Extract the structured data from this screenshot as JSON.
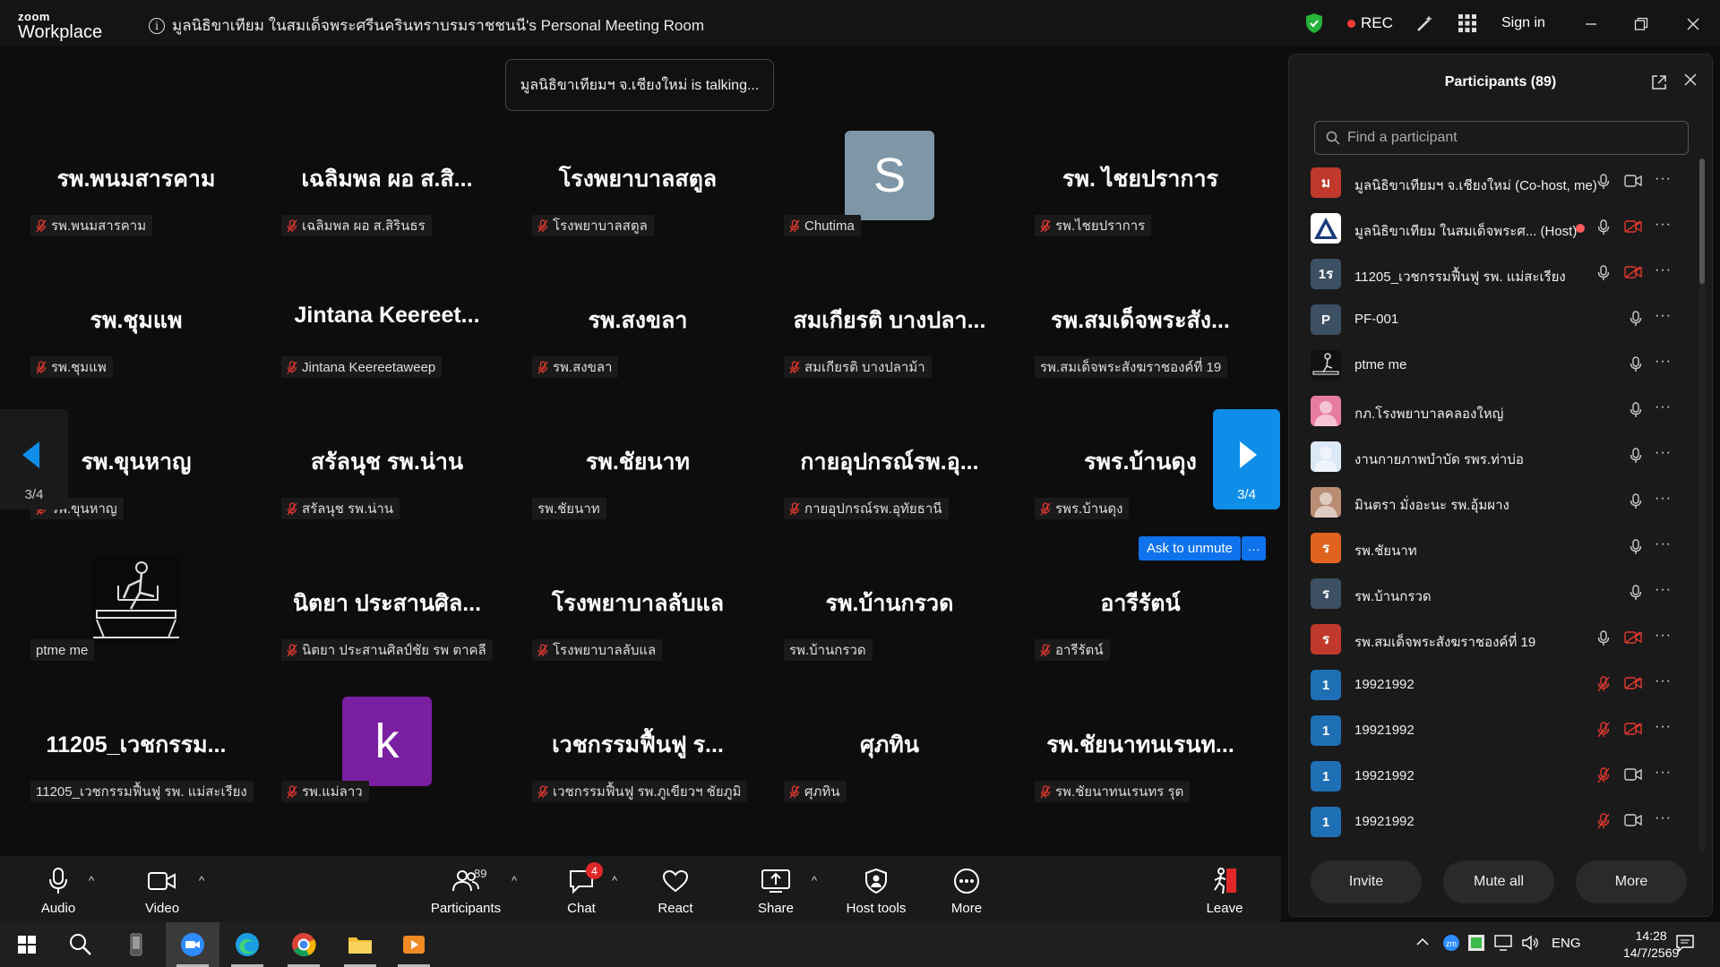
{
  "app": {
    "logo_line1": "zoom",
    "logo_line2": "Workplace",
    "meeting_title": "มูลนิธิขาเทียม ในสมเด็จพระศรีนครินทราบรมราชชนนี's Personal Meeting Room",
    "rec_label": "REC",
    "signin_label": "Sign in"
  },
  "gallery": {
    "talking_banner": "มูลนิธิขาเทียมฯ จ.เชียงใหม่ is talking...",
    "page_indicator_left": "3/4",
    "page_indicator_right": "3/4",
    "ask_unmute_label": "Ask to unmute",
    "ask_more_label": "···",
    "tiles": [
      {
        "big": "รพ.พนมสารคาม",
        "name": "รพ.พนมสารคาม",
        "muted": true
      },
      {
        "big": "เฉลิมพล  ผอ ส.สิ...",
        "name": "เฉลิมพล  ผอ ส.สิรินธร",
        "muted": true
      },
      {
        "big": "โรงพยาบาลสตูล",
        "name": "โรงพยาบาลสตูล",
        "muted": true
      },
      {
        "big": "",
        "name": "Chutima",
        "muted": true,
        "avatar": "S",
        "avatar_color": "#7e96a6"
      },
      {
        "big": "รพ. ไชยปราการ",
        "name": "รพ.ไชยปราการ",
        "muted": true
      },
      {
        "big": "รพ.ชุมแพ",
        "name": "รพ.ชุมแพ",
        "muted": true
      },
      {
        "big": "Jintana  Keereet...",
        "name": "Jintana Keereetaweep",
        "muted": true
      },
      {
        "big": "รพ.สงขลา",
        "name": "รพ.สงขลา",
        "muted": true
      },
      {
        "big": "สมเกียรติ บางปลา...",
        "name": "สมเกียรติ บางปลาม้า",
        "muted": true
      },
      {
        "big": "รพ.สมเด็จพระสัง...",
        "name": "รพ.สมเด็จพระสังฆราชองค์ที่ 19",
        "muted": false
      },
      {
        "big": "รพ.ขุนหาญ",
        "name": "รพ.ขุนหาญ",
        "muted": true
      },
      {
        "big": "สรัลนุช รพ.น่าน",
        "name": "สรัลนุช รพ.น่าน",
        "muted": true
      },
      {
        "big": "รพ.ชัยนาท",
        "name": "รพ.ชัยนาท",
        "muted": false
      },
      {
        "big": "กายอุปกรณ์รพ.อุ...",
        "name": "กายอุปกรณ์รพ.อุทัยธานี",
        "muted": true
      },
      {
        "big": "รพร.บ้านดุง",
        "name": "รพร.บ้านดุง",
        "muted": true
      },
      {
        "big": "",
        "name": "ptme me",
        "muted": false,
        "avatar": "image",
        "avatar_color": "#0a0a0a"
      },
      {
        "big": "นิตยา ประสานศิล...",
        "name": "นิตยา ประสานศิลป์ชัย รพ ตาคลี",
        "muted": true
      },
      {
        "big": "โรงพยาบาลลับแล",
        "name": "โรงพยาบาลลับแล",
        "muted": true
      },
      {
        "big": "รพ.บ้านกรวด",
        "name": "รพ.บ้านกรวด",
        "muted": false
      },
      {
        "big": "อารีรัตน์",
        "name": "อารีรัตน์",
        "muted": true
      },
      {
        "big": "11205_เวชกรรม...",
        "name": "11205_เวชกรรมฟื้นฟู รพ. แม่สะเรียง",
        "muted": false
      },
      {
        "big": "",
        "name": "รพ.แม่ลาว",
        "muted": true,
        "avatar": "k",
        "avatar_color": "#7a1fa2"
      },
      {
        "big": "เวชกรรมฟื้นฟู ร...",
        "name": "เวชกรรมฟื้นฟู รพ.ภูเขียวฯ ชัยภูมิ",
        "muted": true
      },
      {
        "big": "ศุภทิน",
        "name": "ศุภทิน",
        "muted": true
      },
      {
        "big": "รพ.ชัยนาทนเรนท...",
        "name": "รพ.ชัยนาทนเรนทร รุต",
        "muted": true
      }
    ]
  },
  "toolbar": {
    "audio": "Audio",
    "video": "Video",
    "participants": "Participants",
    "participants_count": "89",
    "chat": "Chat",
    "chat_badge": "4",
    "react": "React",
    "share": "Share",
    "host_tools": "Host tools",
    "more": "More",
    "leave": "Leave"
  },
  "panel": {
    "title": "Participants (89)",
    "search_placeholder": "Find a participant",
    "invite": "Invite",
    "mute_all": "Mute all",
    "more": "More",
    "participants": [
      {
        "name": "มูลนิธิขาเทียมฯ จ.เชียงใหม่ (Co-host, me)",
        "initial": "ม",
        "color": "#c0392b",
        "mic": "on",
        "cam": "on"
      },
      {
        "name": "มูลนิธิขาเทียม ในสมเด็จพระศ... (Host)",
        "initial": "",
        "color": "#ffffff",
        "mic": "on",
        "cam": "off",
        "host_rec": true
      },
      {
        "name": "11205_เวชกรรมฟื้นฟู รพ. แม่สะเรียง",
        "initial": "1ร",
        "color": "#3d4f63",
        "mic": "on",
        "cam": "off"
      },
      {
        "name": "PF-001",
        "initial": "P",
        "color": "#3d4f63",
        "mic": "on",
        "cam": "none"
      },
      {
        "name": "ptme me",
        "initial": "",
        "color": "#111111",
        "mic": "on",
        "cam": "none"
      },
      {
        "name": "กภ.โรงพยาบาลคลองใหญ่",
        "initial": "",
        "color": "#e87ca0",
        "mic": "on",
        "cam": "none"
      },
      {
        "name": "งานกายภาพบำบัด รพร.ท่าบ่อ",
        "initial": "",
        "color": "#dbe8f5",
        "mic": "on",
        "cam": "none"
      },
      {
        "name": "มินตรา มั่งอะนะ รพ.อุ้มผาง",
        "initial": "",
        "color": "#b98c74",
        "mic": "on",
        "cam": "none"
      },
      {
        "name": "รพ.ชัยนาท",
        "initial": "ร",
        "color": "#e0641e",
        "mic": "on",
        "cam": "none"
      },
      {
        "name": "รพ.บ้านกรวด",
        "initial": "ร",
        "color": "#3d4f63",
        "mic": "on",
        "cam": "none"
      },
      {
        "name": "รพ.สมเด็จพระสังฆราชองค์ที่ 19",
        "initial": "ร",
        "color": "#c0392b",
        "mic": "on",
        "cam": "off"
      },
      {
        "name": "19921992",
        "initial": "1",
        "color": "#1f6fb5",
        "mic": "off",
        "cam": "off"
      },
      {
        "name": "19921992",
        "initial": "1",
        "color": "#1f6fb5",
        "mic": "off",
        "cam": "off"
      },
      {
        "name": "19921992",
        "initial": "1",
        "color": "#1f6fb5",
        "mic": "off",
        "cam": "on"
      },
      {
        "name": "19921992",
        "initial": "1",
        "color": "#1f6fb5",
        "mic": "off",
        "cam": "on"
      }
    ]
  },
  "taskbar": {
    "lang": "ENG",
    "time": "14:28",
    "date": "14/7/2569"
  }
}
